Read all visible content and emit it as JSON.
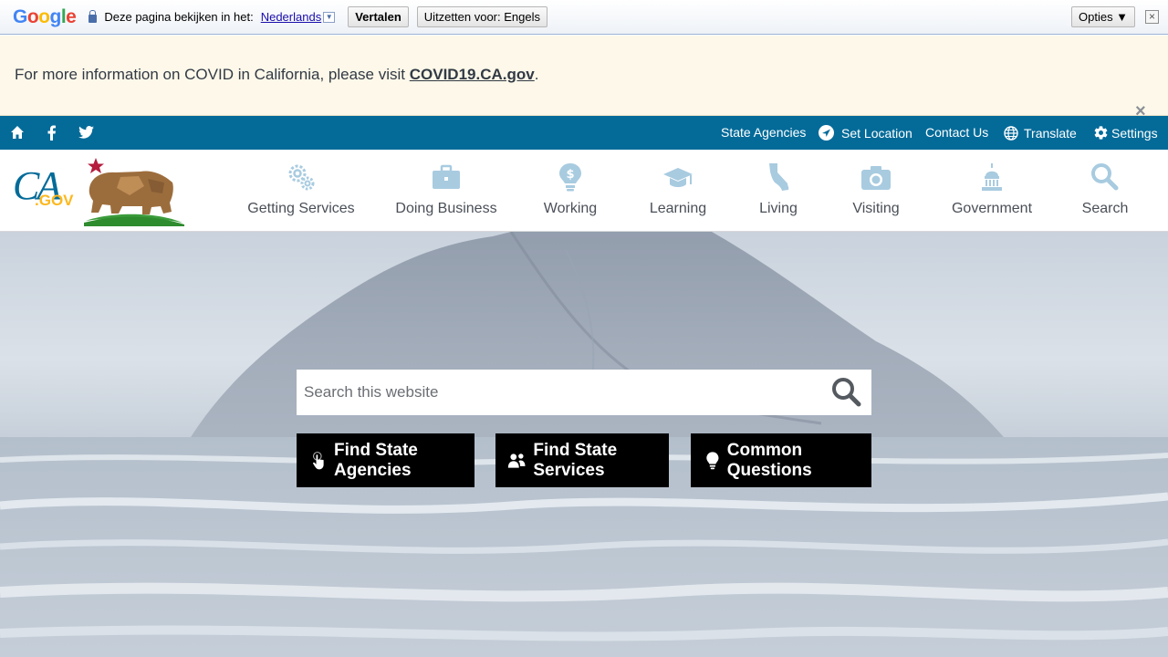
{
  "translate_bar": {
    "logo": "Google",
    "prompt": "Deze pagina bekijken in het:",
    "language": "Nederlands",
    "translate_button": "Vertalen",
    "turn_off_button": "Uitzetten voor: Engels",
    "options_button": "Opties ▼",
    "close": "×"
  },
  "alert": {
    "text": "For more information on COVID in California, please visit ",
    "link": "COVID19.CA.gov",
    "suffix": ".",
    "close": "×"
  },
  "utility": {
    "icons": [
      "home-icon",
      "facebook-icon",
      "twitter-icon"
    ],
    "links": {
      "state_agencies": "State Agencies",
      "set_location": "Set Location",
      "contact_us": "Contact Us",
      "translate": "Translate",
      "settings": "Settings"
    }
  },
  "logo": {
    "text": "CA",
    "subtext": ".GOV"
  },
  "nav": [
    {
      "label": "Getting Services",
      "icon": "gears-icon"
    },
    {
      "label": "Doing Business",
      "icon": "briefcase-icon"
    },
    {
      "label": "Working",
      "icon": "lightbulb-dollar-icon"
    },
    {
      "label": "Learning",
      "icon": "graduation-cap-icon"
    },
    {
      "label": "Living",
      "icon": "california-icon"
    },
    {
      "label": "Visiting",
      "icon": "camera-icon"
    },
    {
      "label": "Government",
      "icon": "capitol-icon"
    },
    {
      "label": "Search",
      "icon": "search-icon"
    }
  ],
  "hero": {
    "search_placeholder": "Search this website",
    "buttons": [
      {
        "label": "Find State Agencies",
        "icon": "pointer-hand-icon"
      },
      {
        "label": "Find State Services",
        "icon": "people-icon"
      },
      {
        "label": "Common Questions",
        "icon": "lightbulb-icon"
      }
    ]
  },
  "colors": {
    "header_blue": "#046b99",
    "nav_icon": "#a8cbe0",
    "alert_bg": "#fdf8e9",
    "hero_button": "#000000"
  }
}
